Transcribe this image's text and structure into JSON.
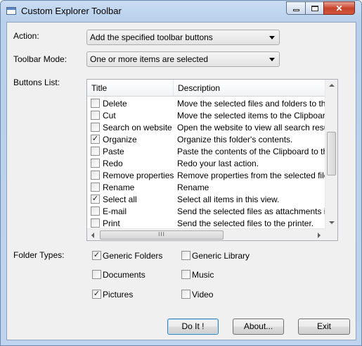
{
  "window": {
    "title": "Custom Explorer Toolbar"
  },
  "form": {
    "action_label": "Action:",
    "action_value": "Add the specified toolbar buttons",
    "mode_label": "Toolbar Mode:",
    "mode_value": "One or more items are selected",
    "buttons_label": "Buttons List:",
    "folder_types_label": "Folder Types:"
  },
  "list": {
    "columns": [
      "Title",
      "Description"
    ],
    "rows": [
      {
        "title": "Delete",
        "description": "Move the selected files and folders to the Re",
        "checked": false
      },
      {
        "title": "Cut",
        "description": "Move the selected items to the Clipboard.",
        "checked": false
      },
      {
        "title": "Search on website",
        "description": "Open the website to view all search results.",
        "checked": false
      },
      {
        "title": "Organize",
        "description": "Organize this folder's contents.",
        "checked": true
      },
      {
        "title": "Paste",
        "description": "Paste the contents of the Clipboard to the c",
        "checked": false
      },
      {
        "title": "Redo",
        "description": "Redo your last action.",
        "checked": false
      },
      {
        "title": "Remove properties",
        "description": "Remove properties from the selected file.",
        "checked": false
      },
      {
        "title": "Rename",
        "description": "Rename",
        "checked": false
      },
      {
        "title": "Select all",
        "description": "Select all items in this view.",
        "checked": true
      },
      {
        "title": "E-mail",
        "description": "Send the selected files as attachments in an",
        "checked": false
      },
      {
        "title": "Print",
        "description": "Send the selected files to the printer.",
        "checked": false
      }
    ]
  },
  "folder_types": [
    {
      "label": "Generic Folders",
      "checked": true
    },
    {
      "label": "Generic Library",
      "checked": false
    },
    {
      "label": "Documents",
      "checked": false
    },
    {
      "label": "Music",
      "checked": false
    },
    {
      "label": "Pictures",
      "checked": true
    },
    {
      "label": "Video",
      "checked": false
    }
  ],
  "buttons": {
    "do_it": "Do It !",
    "about": "About...",
    "exit": "Exit"
  },
  "icons": {
    "check": "✓",
    "close": "✕",
    "scroll_grip": "III"
  }
}
